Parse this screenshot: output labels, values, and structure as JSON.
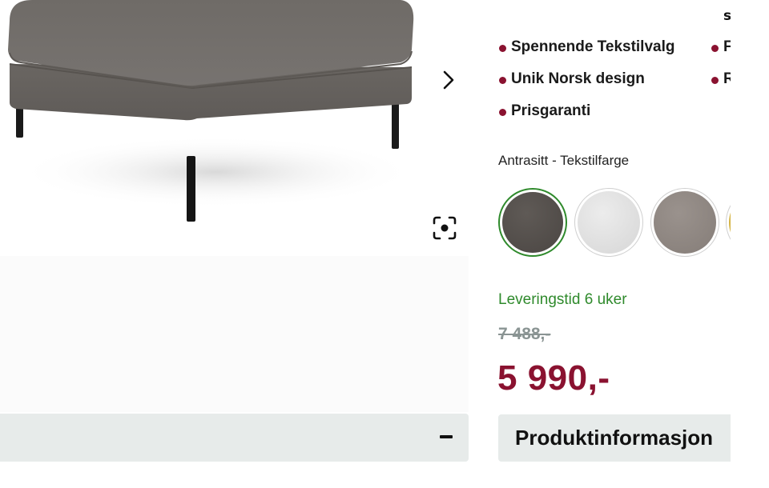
{
  "gallery": {
    "image_alt": "Grå puff med sorte ben",
    "next_icon": "chevron-right-icon",
    "zoom_icon": "fullscreen-icon"
  },
  "accordion": {
    "toggle_icon": "minus-icon"
  },
  "usps": {
    "col1": [
      "Spennende Tekstilvalg",
      "Unik Norsk design",
      "Prisgaranti"
    ],
    "col2": [
      "F",
      "R"
    ],
    "top_partial": "s"
  },
  "color": {
    "label": "Antrasitt - Tekstilfarge",
    "swatches": [
      {
        "name": "antrasitt",
        "hex": "#55504c",
        "selected": true
      },
      {
        "name": "lys grå",
        "hex": "#e2e2e2",
        "selected": false
      },
      {
        "name": "taupe",
        "hex": "#8f8782",
        "selected": false
      },
      {
        "name": "gul",
        "hex": "#d4b342",
        "selected": false
      }
    ]
  },
  "delivery": "Leveringstid 6 uker",
  "price": {
    "old": "7 488,-",
    "new": "5 990,-"
  },
  "product_info_label": "Produktinformasjon",
  "colors": {
    "accent": "#8a1230",
    "success": "#2f8a2c",
    "panel": "#e7ebea",
    "muted": "#8a9493"
  }
}
